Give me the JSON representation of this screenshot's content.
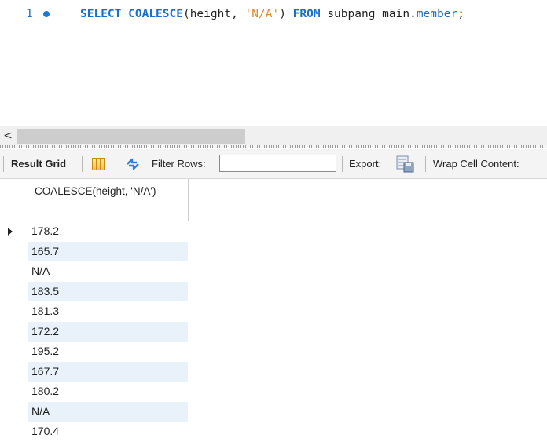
{
  "editor": {
    "line_number": "1",
    "tokens": {
      "kw_select": "SELECT",
      "kw_func": "COALESCE",
      "open": "(height, ",
      "string": "'N/A'",
      "close": ") ",
      "kw_from": "FROM",
      "schema": " subpang_main.",
      "table": "member",
      "semicolon": ";"
    }
  },
  "scrollbar": {
    "left_arrow": "<"
  },
  "toolbar": {
    "result_grid": "Result Grid",
    "filter_rows": "Filter Rows:",
    "filter_value": "",
    "export": "Export:",
    "wrap_cell": "Wrap Cell Content:"
  },
  "grid": {
    "column_header": "COALESCE(height, 'N/A')",
    "rows": [
      "178.2",
      "165.7",
      "N/A",
      "183.5",
      "181.3",
      "172.2",
      "195.2",
      "167.7",
      "180.2",
      "N/A",
      "170.4"
    ]
  },
  "colors": {
    "keyword": "#1a6fc9",
    "string": "#e08a2c",
    "alt_row": "#e9f1fb"
  }
}
